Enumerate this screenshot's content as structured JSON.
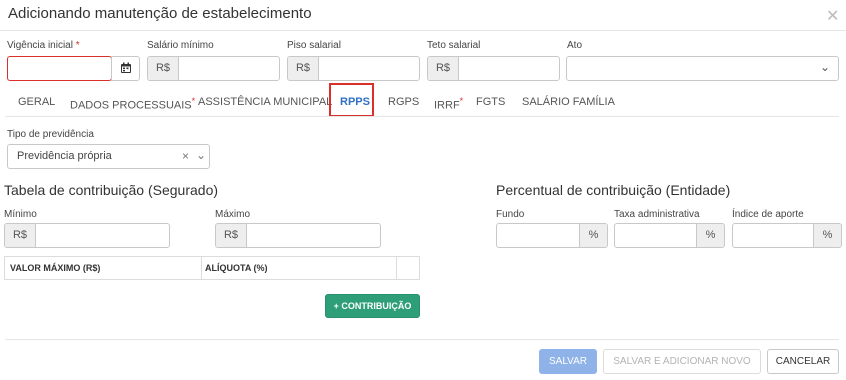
{
  "modal": {
    "title": "Adicionando manutenção de estabelecimento",
    "close_glyph": "✕"
  },
  "fields": {
    "vigencia": {
      "label": "Vigência inicial",
      "required_mark": "*",
      "value": "",
      "icon": "calendar-icon"
    },
    "salario_minimo": {
      "label": "Salário mínimo",
      "prefix": "R$",
      "value": ""
    },
    "piso_salarial": {
      "label": "Piso salarial",
      "prefix": "R$",
      "value": ""
    },
    "teto_salarial": {
      "label": "Teto salarial",
      "prefix": "R$",
      "value": ""
    },
    "ato": {
      "label": "Ato",
      "value": "",
      "chevron": "⌄"
    }
  },
  "tabs": [
    {
      "label": "GERAL",
      "required": false
    },
    {
      "label": "DADOS PROCESSUAIS",
      "required": true
    },
    {
      "label": "ASSISTÊNCIA MUNICIPAL",
      "required": false
    },
    {
      "label": "RPPS",
      "required": false,
      "active": true
    },
    {
      "label": "RGPS",
      "required": false
    },
    {
      "label": "IRRF",
      "required": true
    },
    {
      "label": "FGTS",
      "required": false
    },
    {
      "label": "SALÁRIO FAMÍLIA",
      "required": false
    }
  ],
  "tab_required_mark": "*",
  "tipo_previdencia": {
    "label": "Tipo de previdência",
    "value": "Previdência própria",
    "clear_glyph": "×",
    "chevron": "⌄"
  },
  "segurado": {
    "title": "Tabela de contribuição (Segurado)",
    "minimo": {
      "label": "Mínimo",
      "prefix": "R$",
      "value": ""
    },
    "maximo": {
      "label": "Máximo",
      "prefix": "R$",
      "value": ""
    },
    "table": {
      "columns": [
        "VALOR MÁXIMO (R$)",
        "ALÍQUOTA (%)"
      ]
    },
    "add_button": "+ CONTRIBUIÇÃO"
  },
  "entidade": {
    "title": "Percentual de contribuição (Entidade)",
    "fundo": {
      "label": "Fundo",
      "suffix": "%",
      "value": ""
    },
    "taxa": {
      "label": "Taxa administrativa",
      "suffix": "%",
      "value": ""
    },
    "aporte": {
      "label": "Índice de aporte",
      "suffix": "%",
      "value": ""
    }
  },
  "footer": {
    "salvar": "SALVAR",
    "salvar_novo": "SALVAR E ADICIONAR NOVO",
    "cancelar": "CANCELAR"
  },
  "colors": {
    "accent": "#2f6fc6",
    "required": "#d9302c",
    "primary_disabled": "#8fb3e8",
    "success": "#2e9e78"
  }
}
